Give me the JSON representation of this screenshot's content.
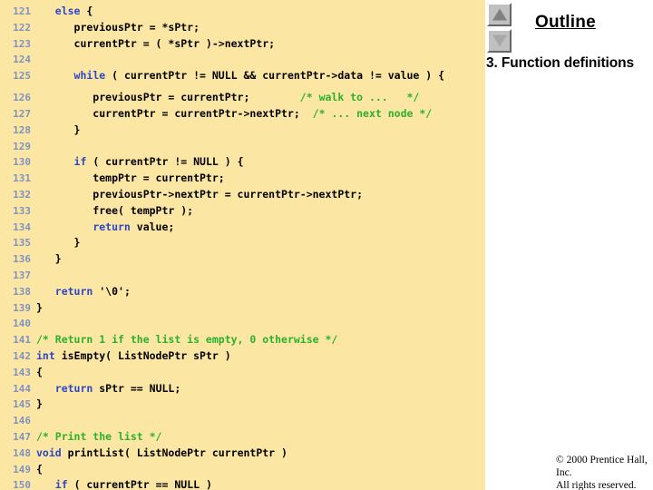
{
  "slide": {
    "background": "#ffffff",
    "code_panel_color": "#fce6a3",
    "lineno_color": "#7e93c4",
    "keyword_color": "#2b47c8",
    "comment_color": "#2cb02c"
  },
  "outline": {
    "title": "Outline",
    "nav_up_icon": "triangle-up-icon",
    "nav_down_icon": "triangle-down-icon",
    "entries": [
      {
        "label": "3. Function definitions"
      }
    ]
  },
  "copyright": {
    "line1": "© 2000 Prentice Hall, Inc.",
    "line2": "All rights reserved."
  },
  "code": {
    "language": "c",
    "lines": [
      {
        "no": "121",
        "segments": [
          {
            "t": "   ",
            "c": "plain"
          },
          {
            "t": "else",
            "c": "kw"
          },
          {
            "t": " {",
            "c": "plain"
          }
        ]
      },
      {
        "no": "122",
        "segments": [
          {
            "t": "      previousPtr = *sPtr;",
            "c": "plain"
          }
        ]
      },
      {
        "no": "123",
        "segments": [
          {
            "t": "      currentPtr = ( *sPtr )->nextPtr;",
            "c": "plain"
          }
        ]
      },
      {
        "no": "124",
        "segments": [
          {
            "t": "",
            "c": "plain"
          }
        ]
      },
      {
        "no": "125",
        "segments": [
          {
            "t": "      ",
            "c": "plain"
          },
          {
            "t": "while",
            "c": "kw"
          },
          {
            "t": " ( currentPtr != NULL && currentPtr->data != value ) {",
            "c": "plain"
          }
        ]
      },
      {
        "no": "126",
        "segments": [
          {
            "t": "         previousPtr = currentPtr;        ",
            "c": "plain"
          },
          {
            "t": "/* walk to ...   */",
            "c": "cm"
          }
        ]
      },
      {
        "no": "127",
        "segments": [
          {
            "t": "         currentPtr = currentPtr->nextPtr;  ",
            "c": "plain"
          },
          {
            "t": "/* ... next node */",
            "c": "cm"
          }
        ]
      },
      {
        "no": "128",
        "segments": [
          {
            "t": "      }",
            "c": "plain"
          }
        ]
      },
      {
        "no": "129",
        "segments": [
          {
            "t": "",
            "c": "plain"
          }
        ]
      },
      {
        "no": "130",
        "segments": [
          {
            "t": "      ",
            "c": "plain"
          },
          {
            "t": "if",
            "c": "kw"
          },
          {
            "t": " ( currentPtr != NULL ) {",
            "c": "plain"
          }
        ]
      },
      {
        "no": "131",
        "segments": [
          {
            "t": "         tempPtr = currentPtr;",
            "c": "plain"
          }
        ]
      },
      {
        "no": "132",
        "segments": [
          {
            "t": "         previousPtr->nextPtr = currentPtr->nextPtr;",
            "c": "plain"
          }
        ]
      },
      {
        "no": "133",
        "segments": [
          {
            "t": "         free( tempPtr );",
            "c": "plain"
          }
        ]
      },
      {
        "no": "134",
        "segments": [
          {
            "t": "         ",
            "c": "plain"
          },
          {
            "t": "return",
            "c": "kw"
          },
          {
            "t": " value;",
            "c": "plain"
          }
        ]
      },
      {
        "no": "135",
        "segments": [
          {
            "t": "      }",
            "c": "plain"
          }
        ]
      },
      {
        "no": "136",
        "segments": [
          {
            "t": "   }",
            "c": "plain"
          }
        ]
      },
      {
        "no": "137",
        "segments": [
          {
            "t": "",
            "c": "plain"
          }
        ]
      },
      {
        "no": "138",
        "segments": [
          {
            "t": "   ",
            "c": "plain"
          },
          {
            "t": "return",
            "c": "kw"
          },
          {
            "t": " '\\0';",
            "c": "plain"
          }
        ]
      },
      {
        "no": "139",
        "segments": [
          {
            "t": "}",
            "c": "plain"
          }
        ]
      },
      {
        "no": "140",
        "segments": [
          {
            "t": "",
            "c": "plain"
          }
        ]
      },
      {
        "no": "141",
        "segments": [
          {
            "t": "/* Return 1 if the list is empty, 0 otherwise */",
            "c": "cm"
          }
        ]
      },
      {
        "no": "142",
        "segments": [
          {
            "t": "int",
            "c": "kw"
          },
          {
            "t": " isEmpty( ListNodePtr sPtr )",
            "c": "plain"
          }
        ]
      },
      {
        "no": "143",
        "segments": [
          {
            "t": "{",
            "c": "plain"
          }
        ]
      },
      {
        "no": "144",
        "segments": [
          {
            "t": "   ",
            "c": "plain"
          },
          {
            "t": "return",
            "c": "kw"
          },
          {
            "t": " sPtr == NULL;",
            "c": "plain"
          }
        ]
      },
      {
        "no": "145",
        "segments": [
          {
            "t": "}",
            "c": "plain"
          }
        ]
      },
      {
        "no": "146",
        "segments": [
          {
            "t": "",
            "c": "plain"
          }
        ]
      },
      {
        "no": "147",
        "segments": [
          {
            "t": "/* Print the list */",
            "c": "cm"
          }
        ]
      },
      {
        "no": "148",
        "segments": [
          {
            "t": "void",
            "c": "kw"
          },
          {
            "t": " printList( ListNodePtr currentPtr )",
            "c": "plain"
          }
        ]
      },
      {
        "no": "149",
        "segments": [
          {
            "t": "{",
            "c": "plain"
          }
        ]
      },
      {
        "no": "150",
        "segments": [
          {
            "t": "   ",
            "c": "plain"
          },
          {
            "t": "if",
            "c": "kw"
          },
          {
            "t": " ( currentPtr == NULL )",
            "c": "plain"
          }
        ]
      }
    ]
  }
}
